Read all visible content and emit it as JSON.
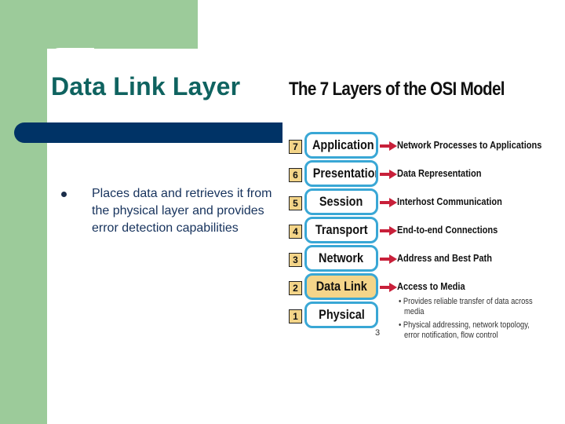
{
  "slide": {
    "title": "Data Link Layer",
    "bullets": [
      "Places data and retrieves it from the physical layer and provides error detection capabilities"
    ],
    "page_number": "3",
    "colors": {
      "accent_green": "#9ccb9a",
      "title_teal": "#0f6360",
      "bar_navy": "#003366",
      "body_text": "#16325c"
    }
  },
  "figure": {
    "title": "The 7 Layers of the OSI Model",
    "layers": [
      {
        "number": "7",
        "name": "Application",
        "description": "Network Processes to Applications",
        "highlight": false
      },
      {
        "number": "6",
        "name": "Presentation",
        "description": "Data Representation",
        "highlight": false
      },
      {
        "number": "5",
        "name": "Session",
        "description": "Interhost Communication",
        "highlight": false
      },
      {
        "number": "4",
        "name": "Transport",
        "description": "End-to-end Connections",
        "highlight": false
      },
      {
        "number": "3",
        "name": "Network",
        "description": "Address and Best Path",
        "highlight": false
      },
      {
        "number": "2",
        "name": "Data Link",
        "description": "Access to Media",
        "highlight": true
      },
      {
        "number": "1",
        "name": "Physical",
        "description": "",
        "highlight": false
      }
    ],
    "data_link_details": [
      "• Provides reliable transfer of data across",
      "media",
      "• Physical addressing, network topology,",
      "error notification, flow control"
    ],
    "colors": {
      "layer_border": "#39a7d5",
      "number_fill": "#f3d488",
      "highlight_fill": "#f4d58a",
      "arrow": "#c8203a"
    }
  }
}
